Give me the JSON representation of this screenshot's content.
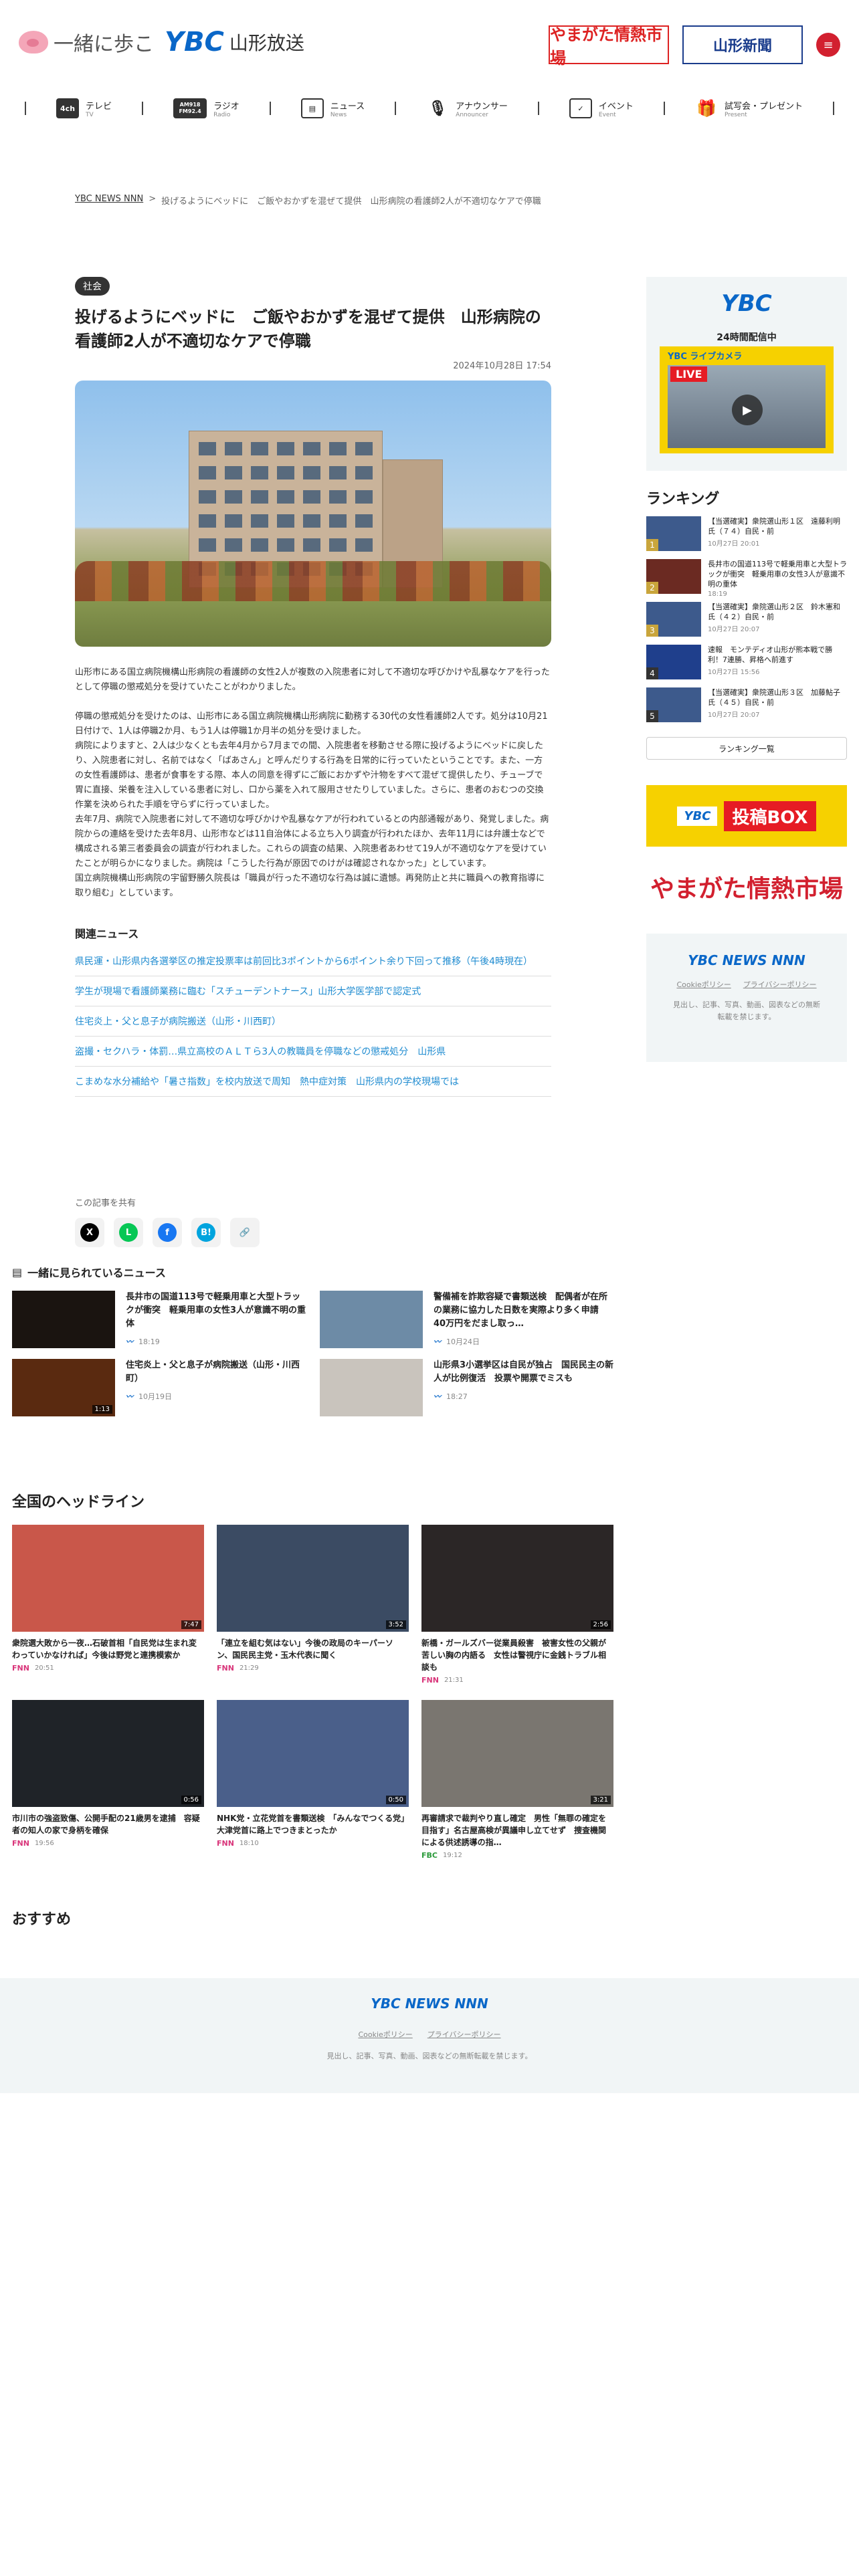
{
  "header": {
    "tagline": "一緒に歩こ",
    "brand": "YBC",
    "station": "山形放送",
    "banner_market": "やまがた情熱市場",
    "banner_news": "山形新聞"
  },
  "nav": [
    {
      "icon": "tv-icon",
      "badge": "4ch",
      "label": "テレビ",
      "en": "TV"
    },
    {
      "icon": "radio-icon",
      "badge": "AM918 FM92.4",
      "label": "ラジオ",
      "en": "Radio"
    },
    {
      "icon": "news-icon",
      "badge": "",
      "label": "ニュース",
      "en": "News"
    },
    {
      "icon": "microphone-icon",
      "badge": "",
      "label": "アナウンサー",
      "en": "Announcer"
    },
    {
      "icon": "calendar-icon",
      "badge": "",
      "label": "イベント",
      "en": "Event"
    },
    {
      "icon": "gift-icon",
      "badge": "",
      "label": "試写会・プレゼント",
      "en": "Present"
    }
  ],
  "breadcrumb": {
    "home": "YBC NEWS NNN",
    "sep": ">",
    "current": "投げるようにベッドに　ご飯やおかずを混ぜて提供　山形病院の看護師2人が不適切なケアで停職"
  },
  "article": {
    "category": "社会",
    "title": "投げるようにベッドに　ご飯やおかずを混ぜて提供　山形病院の看護師2人が不適切なケアで停職",
    "datetime": "2024年10月28日 17:54",
    "lead": "山形市にある国立病院機構山形病院の看護師の女性2人が複数の入院患者に対して不適切な呼びかけや乱暴なケアを行ったとして停職の懲戒処分を受けていたことがわかりました。",
    "body": [
      "停職の懲戒処分を受けたのは、山形市にある国立病院機構山形病院に勤務する30代の女性看護師2人です。処分は10月21日付けで、1人は停職2か月、もう1人は停職1か月半の処分を受けました。",
      "病院によりますと、2人は少なくとも去年4月から7月までの間、入院患者を移動させる際に投げるようにベッドに戻したり、入院患者に対し、名前ではなく「ばあさん」と呼んだりする行為を日常的に行っていたということです。また、一方の女性看護師は、患者が食事をする際、本人の同意を得ずにご飯におかずや汁物をすべて混ぜて提供したり、チューブで胃に直接、栄養を注入している患者に対し、口から薬を入れて服用させたりしていました。さらに、患者のおむつの交換作業を決められた手順を守らずに行っていました。",
      "去年7月、病院で入院患者に対して不適切な呼びかけや乱暴なケアが行われているとの内部通報があり、発覚しました。病院からの連絡を受けた去年8月、山形市などは11自治体による立ち入り調査が行われたほか、去年11月には弁護士などで構成される第三者委員会の調査が行われました。これらの調査の結果、入院患者あわせて19人が不適切なケアを受けていたことが明らかになりました。病院は「こうした行為が原因でのけがは確認されなかった」としています。",
      "国立病院機構山形病院の宇留野勝久院長は「職員が行った不適切な行為は誠に遺憾。再発防止と共に職員への教育指導に取り組む」としています。"
    ],
    "related_title": "関連ニュース",
    "related": [
      "県民運・山形県内各選挙区の推定投票率は前回比3ポイントから6ポイント余り下回って推移（午後4時現在）",
      "学生が現場で看護師業務に臨む「スチューデントナース」山形大学医学部で認定式",
      "住宅炎上・父と息子が病院搬送（山形・川西町）",
      "盗撮・セクハラ・体罰…県立高校のＡＬＴら3人の教職員を停職などの懲戒処分　山形県",
      "こまめな水分補給や「暑さ指数」を校内放送で周知　熱中症対策　山形県内の学校現場では"
    ]
  },
  "share": {
    "label": "この記事を共有",
    "buttons": [
      {
        "name": "share-x-button",
        "glyph": "X",
        "color": "#000000"
      },
      {
        "name": "share-line-button",
        "glyph": "L",
        "color": "#06c755"
      },
      {
        "name": "share-facebook-button",
        "glyph": "f",
        "color": "#1877f2"
      },
      {
        "name": "share-hatena-button",
        "glyph": "B!",
        "color": "#00a4de"
      },
      {
        "name": "share-link-button",
        "glyph": "🔗",
        "color": "#888888"
      }
    ]
  },
  "sidebar": {
    "live_brand": "YBC",
    "live_hours": "24時間配信中",
    "live_banner": "YBC ライブカメラ",
    "live_badge": "LIVE",
    "ranking_title": "ランキング",
    "ranking": [
      {
        "rank": "1",
        "title": "【当選確実】衆院選山形１区　遠藤利明氏（７４）自民・前",
        "time": "10月27日 20:01"
      },
      {
        "rank": "2",
        "title": "長井市の国道113号で軽乗用車と大型トラックが衝突　軽乗用車の女性3人が意識不明の重体",
        "time": "18:19"
      },
      {
        "rank": "3",
        "title": "【当選確実】衆院選山形２区　鈴木憲和氏（４２）自民・前",
        "time": "10月27日 20:07"
      },
      {
        "rank": "4",
        "title": "速報　モンテディオ山形が熊本戦で勝利！7連勝、昇格へ前進す",
        "time": "10月27日 15:56"
      },
      {
        "rank": "5",
        "title": "【当選確実】衆院選山形３区　加藤鮎子氏（４５）自民・前",
        "time": "10月27日 20:07"
      }
    ],
    "ranking_more": "ランキング一覧",
    "ad_toko_brand": "YBC",
    "ad_toko": "投稿BOX",
    "ad_market": "やまがた情熱市場",
    "news_logo": "YBC NEWS NNN",
    "cookie": "Cookieポリシー",
    "privacy": "プライバシーポリシー",
    "note": "見出し、記事、写真、動画、図表などの無断転載を禁じます。"
  },
  "seen": {
    "title": "一緒に見られているニュース",
    "items": [
      {
        "title": "長井市の国道113号で軽乗用車と大型トラックが衝突　軽乗用車の女性3人が意識不明の重体",
        "time": "18:19",
        "duration": "",
        "bg": "#1a1410"
      },
      {
        "title": "警備補を詐欺容疑で書類送検　配偶者が在所の業務に協力した日数を実際より多く申請　40万円をだまし取っ…",
        "time": "10月24日",
        "duration": "",
        "bg": "#6d8ba6"
      },
      {
        "title": "住宅炎上・父と息子が病院搬送（山形・川西町）",
        "time": "10月19日",
        "duration": "1:13",
        "bg": "#5a2a10"
      },
      {
        "title": "山形県3小選挙区は自民が独占　国民民主の新人が比例復活　投票や開票でミスも",
        "time": "18:27",
        "duration": "",
        "bg": "#c9c4bd"
      }
    ]
  },
  "national": {
    "title": "全国のヘッドライン",
    "items": [
      {
        "title": "衆院選大敗から一夜…石破首相「自民党は生まれ変わっていかなければ」今後は野党と連携模索か",
        "source": "FNN",
        "time": "20:51",
        "duration": "7:47",
        "bg": "#c9574a"
      },
      {
        "title": "「連立を組む気はない」今後の政局のキーパーソン、国民民主党・玉木代表に聞く",
        "source": "FNN",
        "time": "21:29",
        "duration": "3:52",
        "bg": "#3b4b63"
      },
      {
        "title": "新橋・ガールズバー従業員殺害　被害女性の父親が苦しい胸の内語る　女性は警視庁に金銭トラブル相談も",
        "source": "FNN",
        "time": "21:31",
        "duration": "2:56",
        "bg": "#2b2626"
      },
      {
        "title": "市川市の強盗致傷、公開手配の21歳男を逮捕　容疑者の知人の家で身柄を確保",
        "source": "FNN",
        "time": "19:56",
        "duration": "0:56",
        "bg": "#1f2328"
      },
      {
        "title": "NHK党・立花党首を書類送検　「みんなでつくる党」大津党首に路上でつきまとったか",
        "source": "FNN",
        "time": "18:10",
        "duration": "0:50",
        "bg": "#4a5f8a"
      },
      {
        "title": "再審請求で裁判やり直し確定　男性「無罪の確定を目指す」名古屋高検が異議申し立てせず　捜査機関による供述誘導の指…",
        "source": "FBC",
        "time": "19:12",
        "duration": "3:21",
        "bg": "#7a7670"
      }
    ]
  },
  "recommend": {
    "title": "おすすめ"
  },
  "footer": {
    "logo": "YBC NEWS NNN",
    "cookie": "Cookieポリシー",
    "privacy": "プライバシーポリシー",
    "note": "見出し、記事、写真、動画、図表などの無断転載を禁じます。"
  }
}
